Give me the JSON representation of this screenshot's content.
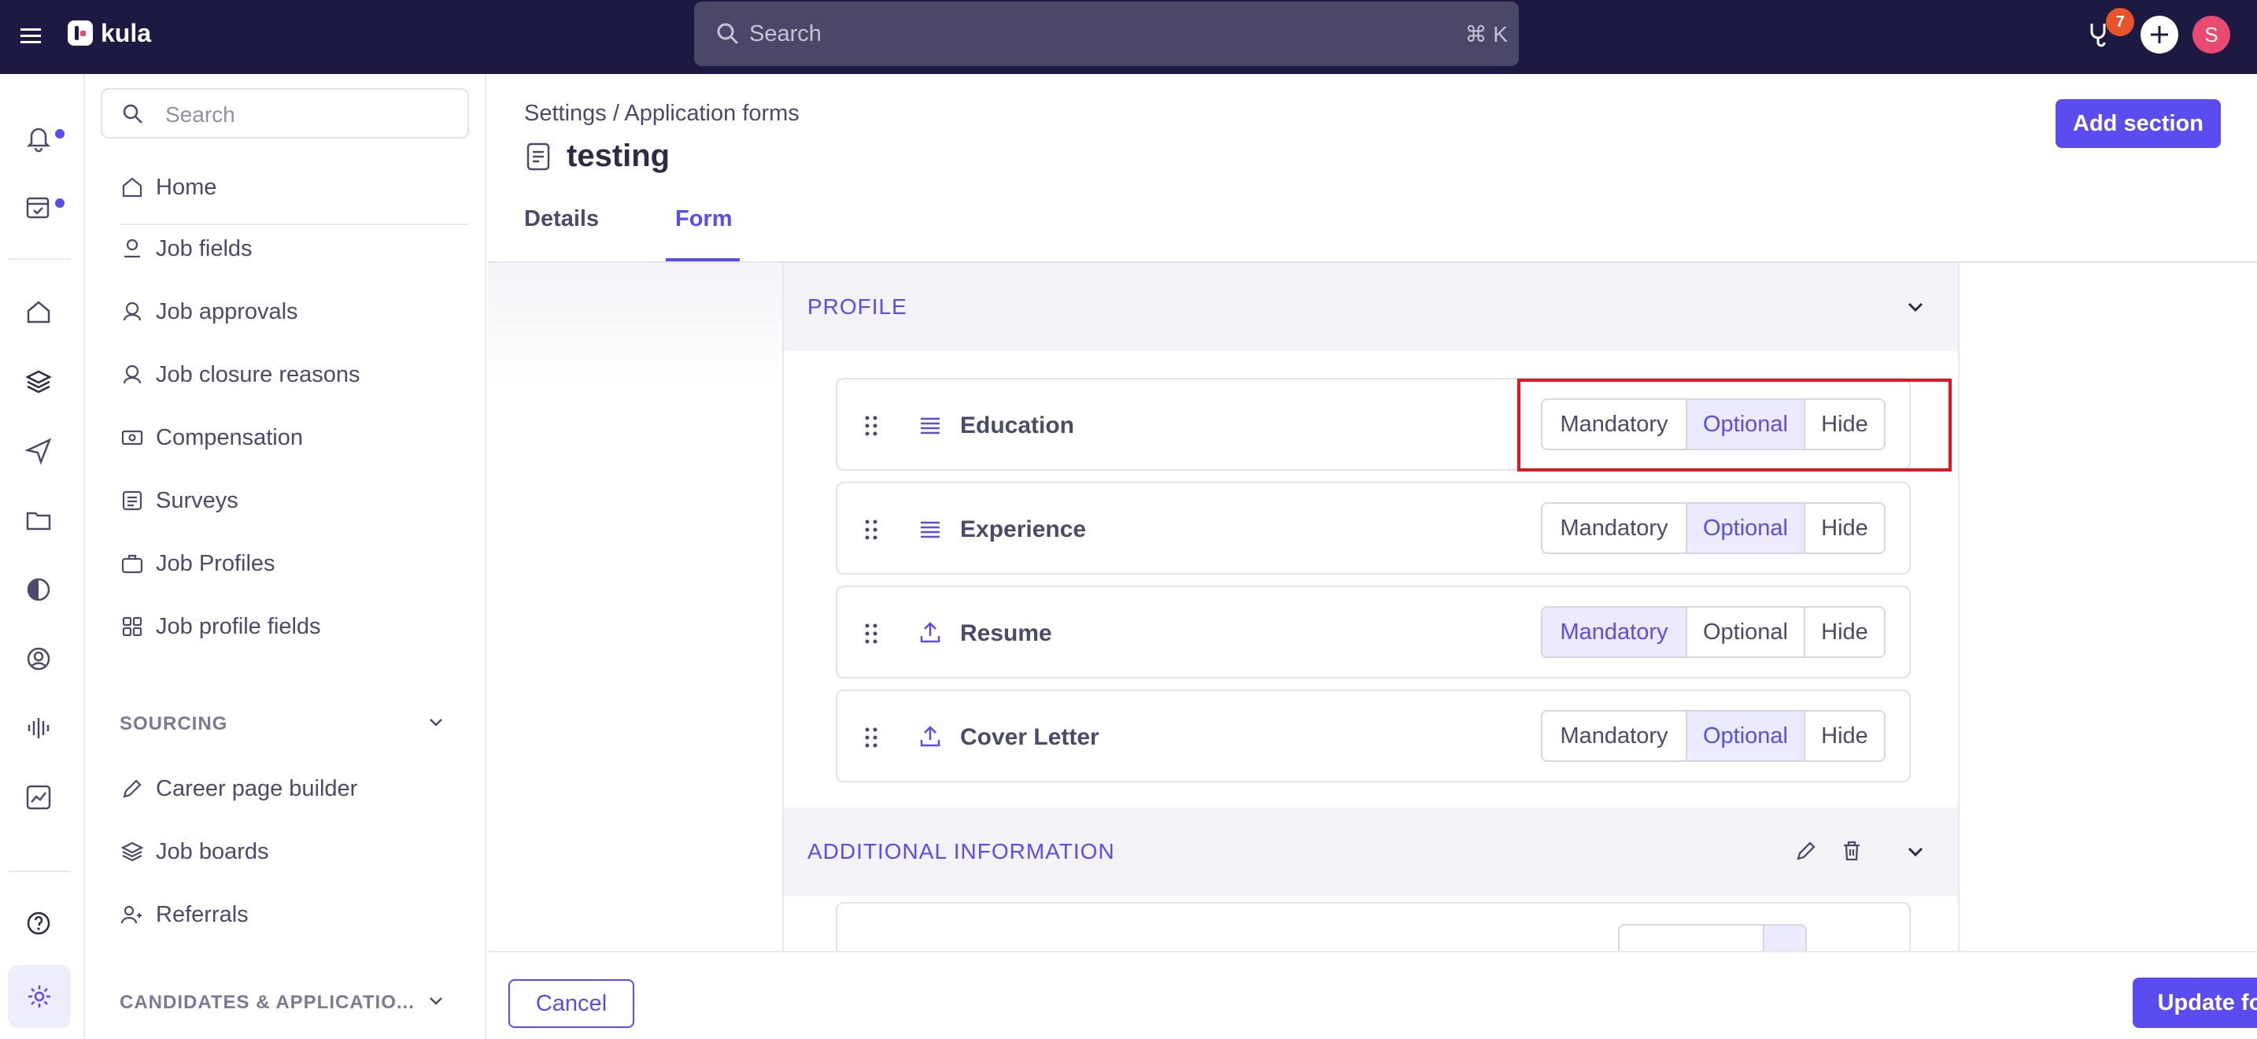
{
  "app": {
    "name": "kula"
  },
  "topbar": {
    "search_placeholder": "Search",
    "search_shortcut": "⌘ K",
    "notification_count": "7",
    "avatar_initial": "S"
  },
  "sidebar": {
    "search_placeholder": "Search",
    "home_label": "Home",
    "items": [
      {
        "label": "Job fields",
        "icon": "job-fields-icon"
      },
      {
        "label": "Job approvals",
        "icon": "job-approvals-icon"
      },
      {
        "label": "Job closure reasons",
        "icon": "job-closure-icon"
      },
      {
        "label": "Compensation",
        "icon": "compensation-icon"
      },
      {
        "label": "Surveys",
        "icon": "surveys-icon"
      },
      {
        "label": "Job Profiles",
        "icon": "briefcase-icon"
      },
      {
        "label": "Job profile fields",
        "icon": "grid-icon"
      }
    ],
    "sourcing_section": "SOURCING",
    "sourcing_items": [
      {
        "label": "Career page builder",
        "icon": "pencil-icon"
      },
      {
        "label": "Job boards",
        "icon": "layers-icon"
      },
      {
        "label": "Referrals",
        "icon": "users-icon"
      }
    ],
    "candidates_section": "CANDIDATES & APPLICATIO..."
  },
  "header": {
    "breadcrumb": "Settings / Application forms",
    "title": "testing",
    "add_section_label": "Add section",
    "tabs": [
      {
        "label": "Details"
      },
      {
        "label": "Form"
      }
    ],
    "active_tab": "Form"
  },
  "form": {
    "sections": [
      {
        "title": "PROFILE",
        "fields": [
          {
            "label": "Education",
            "type_icon": "text-lines-icon",
            "options": [
              "Mandatory",
              "Optional",
              "Hide"
            ],
            "selected": "Optional"
          },
          {
            "label": "Experience",
            "type_icon": "text-lines-icon",
            "options": [
              "Mandatory",
              "Optional",
              "Hide"
            ],
            "selected": "Optional"
          },
          {
            "label": "Resume",
            "type_icon": "upload-icon",
            "options": [
              "Mandatory",
              "Optional",
              "Hide"
            ],
            "selected": "Mandatory"
          },
          {
            "label": "Cover Letter",
            "type_icon": "upload-icon",
            "options": [
              "Mandatory",
              "Optional",
              "Hide"
            ],
            "selected": "Optional"
          }
        ]
      },
      {
        "title": "ADDITIONAL INFORMATION"
      }
    ]
  },
  "footer": {
    "cancel_label": "Cancel",
    "update_label": "Update form"
  },
  "colors": {
    "accent": "#5b4cf0",
    "topbar": "#1c1a42",
    "selected_bg": "#eceafd",
    "highlight": "#e8131c",
    "badge": "#e8532a",
    "avatar": "#e84a72"
  }
}
